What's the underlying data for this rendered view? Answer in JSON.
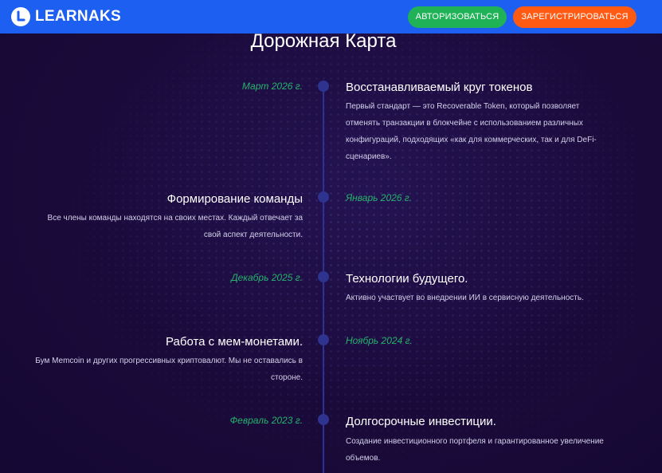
{
  "header": {
    "logo_text": "LEARNAKS",
    "login_label": "АВТОРИЗОВАТЬСЯ",
    "register_label": "ЗАРЕГИСТРИРОВАТЬСЯ"
  },
  "roadmap": {
    "title": "Дорожная Карта",
    "items": [
      {
        "date": "Март 2026 г.",
        "title": "Восстанавливаемый круг токенов",
        "desc_lines": [
          "Первый стандарт — это Recoverable Token, который позволяет",
          "отменять транзакции в блокчейне с использованием различных",
          "конфигураций, подходящих «как для коммерческих, так и для DeFi-",
          "сценариев»."
        ]
      },
      {
        "date": "Январь 2026 г.",
        "title": "Формирование команды",
        "desc_lines": [
          "Все члены команды находятся на своих местах. Каждый отвечает за",
          "свой аспект деятельности."
        ]
      },
      {
        "date": "Декабрь 2025 г.",
        "title": "Технологии будущего.",
        "desc_lines": [
          "Активно участвует во внедрении ИИ в сервисную деятельность."
        ]
      },
      {
        "date": "Ноябрь 2024 г.",
        "title": "Работа с мем-монетами.",
        "desc_lines": [
          "Бум Memcoin и других прогрессивных криптовалют. Мы не оставались в",
          "стороне."
        ]
      },
      {
        "date": "Февраль 2023 г.",
        "title": "Долгосрочные инвестиции.",
        "desc_lines": [
          "Создание инвестиционного портфеля и гарантированное увеличение",
          "объемов."
        ]
      }
    ]
  },
  "colors": {
    "header_bg": "#1d5ff0",
    "login_btn": "#1fb257",
    "register_btn": "#ff5a14",
    "date_green": "#26b36b",
    "page_bg": "#1a0a3a",
    "timeline": "#2f2f96"
  }
}
